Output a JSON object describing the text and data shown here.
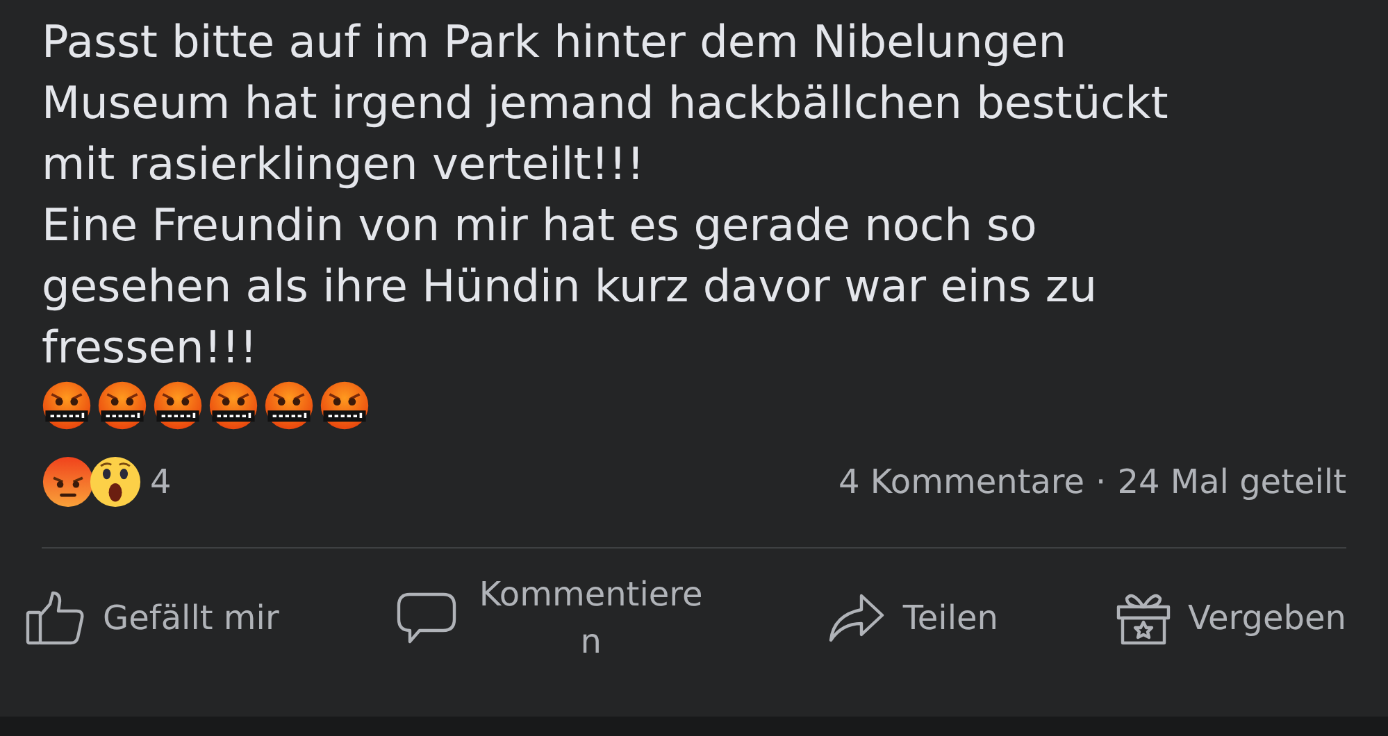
{
  "post": {
    "paragraphs": [
      {
        "text": "Passt bitte auf im Park hinter dem Nibelungen Museum hat irgend jemand hackbällchen bestückt mit rasierklingen verteilt!!!"
      },
      {
        "text": "Eine Freundin von mir hat es gerade noch so gesehen als ihre Hündin kurz davor war eins zu fressen!!!",
        "emojis": [
          {
            "kind": "cursing"
          },
          {
            "kind": "cursing"
          },
          {
            "kind": "cursing"
          },
          {
            "kind": "cursing"
          },
          {
            "kind": "cursing"
          },
          {
            "kind": "cursing"
          }
        ]
      }
    ]
  },
  "reactions": {
    "icons": [
      {
        "kind": "angry"
      },
      {
        "kind": "wow"
      }
    ],
    "count": "4",
    "comments": "4 Kommentare",
    "separator": "·",
    "shares": "24 Mal geteilt"
  },
  "actions": [
    {
      "kind": "like",
      "label": "Gefällt mir"
    },
    {
      "kind": "comment",
      "label": "Kommentieren"
    },
    {
      "kind": "share",
      "label": "Teilen"
    },
    {
      "kind": "gift",
      "label": "Vergeben"
    }
  ]
}
